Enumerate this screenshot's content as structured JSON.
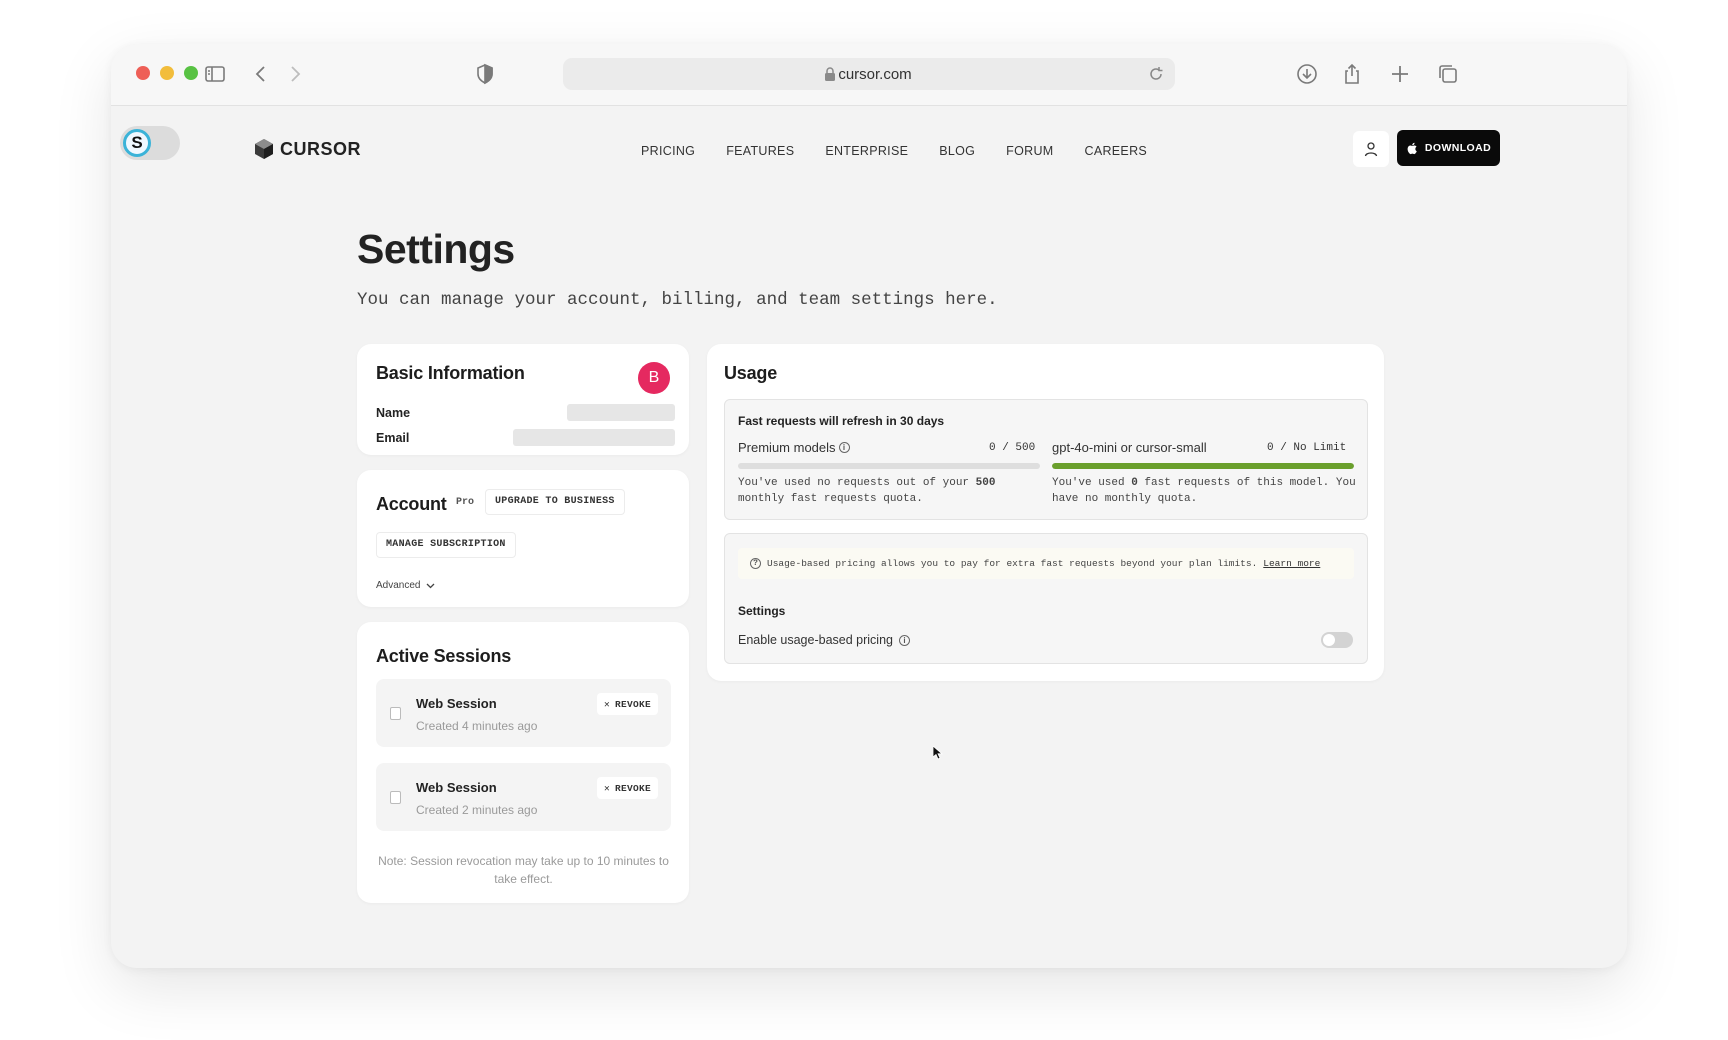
{
  "browser": {
    "url": "cursor.com"
  },
  "extension": {
    "letter": "S"
  },
  "site": {
    "logo_text": "CURSOR",
    "nav": [
      "PRICING",
      "FEATURES",
      "ENTERPRISE",
      "BLOG",
      "FORUM",
      "CAREERS"
    ],
    "download_label": "DOWNLOAD"
  },
  "page": {
    "title": "Settings",
    "subtitle": "You can manage your account, billing, and team settings here."
  },
  "basic_info": {
    "title": "Basic Information",
    "avatar_letter": "B",
    "name_label": "Name",
    "email_label": "Email"
  },
  "account": {
    "title": "Account",
    "plan_badge": "Pro",
    "upgrade_label": "UPGRADE TO BUSINESS",
    "manage_label": "MANAGE SUBSCRIPTION",
    "advanced_label": "Advanced"
  },
  "sessions": {
    "title": "Active Sessions",
    "revoke_label": "REVOKE",
    "items": [
      {
        "name": "Web Session",
        "created": "Created 4 minutes ago"
      },
      {
        "name": "Web Session",
        "created": "Created 2 minutes ago"
      }
    ],
    "note": "Note: Session revocation may take up to 10 minutes to take effect."
  },
  "usage": {
    "title": "Usage",
    "refresh_text": "Fast requests will refresh in 30 days",
    "models": [
      {
        "label": "Premium models",
        "count": "0 / 500",
        "fill_fraction": 0,
        "desc_prefix": "You've used no requests out of your ",
        "desc_bold": "500",
        "desc_suffix": " monthly fast requests quota."
      },
      {
        "label": "gpt-4o-mini or cursor-small",
        "count": "0 / No Limit",
        "fill_fraction": 1,
        "desc_prefix": "You've used ",
        "desc_bold": "0",
        "desc_suffix": " fast requests of this model. You have no monthly quota."
      }
    ],
    "banner_text": "Usage-based pricing allows you to pay for extra fast requests beyond your plan limits.",
    "banner_link": "Learn more",
    "settings_title": "Settings",
    "toggle_label": "Enable usage-based pricing",
    "toggle_on": false
  },
  "colors": {
    "avatar": "#e52960",
    "progress_fill": "#6a9f2c",
    "download_bg": "#0a0a0a"
  }
}
